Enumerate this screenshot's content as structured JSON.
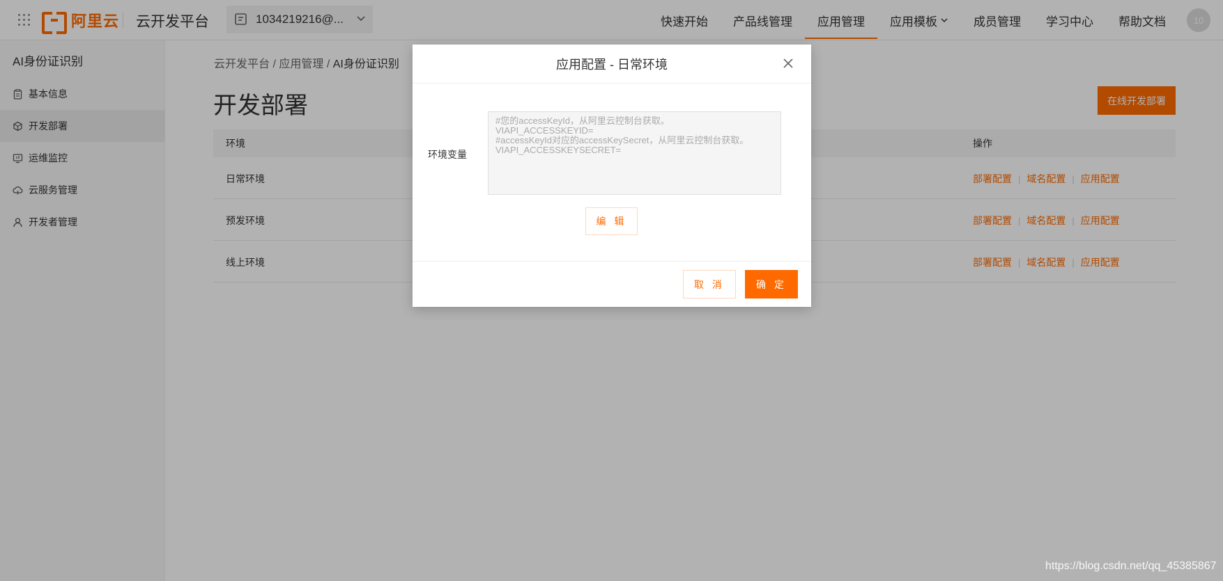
{
  "topbar": {
    "brand": "阿里云",
    "platform_title": "云开发平台",
    "account": "1034219216@...",
    "nav": [
      {
        "label": "快速开始",
        "active": false
      },
      {
        "label": "产品线管理",
        "active": false
      },
      {
        "label": "应用管理",
        "active": true
      },
      {
        "label": "应用模板",
        "active": false,
        "has_dropdown": true
      },
      {
        "label": "成员管理",
        "active": false
      },
      {
        "label": "学习中心",
        "active": false
      },
      {
        "label": "帮助文档",
        "active": false
      }
    ],
    "avatar_text": "10"
  },
  "sidebar": {
    "title": "AI身份证识别",
    "items": [
      {
        "label": "基本信息",
        "icon": "clipboard-icon",
        "active": false
      },
      {
        "label": "开发部署",
        "icon": "cube-icon",
        "active": true
      },
      {
        "label": "运维监控",
        "icon": "monitor-icon",
        "active": false
      },
      {
        "label": "云服务管理",
        "icon": "cloud-icon",
        "active": false
      },
      {
        "label": "开发者管理",
        "icon": "user-icon",
        "active": false
      }
    ]
  },
  "main": {
    "breadcrumb": [
      "云开发平台",
      "应用管理",
      "AI身份证识别"
    ],
    "breadcrumb_sep": " / ",
    "page_title": "开发部署",
    "online_deploy_label": "在线开发部署",
    "table": {
      "headers": [
        "环境",
        "操作"
      ],
      "rows": [
        {
          "env": "日常环境"
        },
        {
          "env": "预发环境"
        },
        {
          "env": "线上环境"
        }
      ],
      "ops": [
        "部署配置",
        "域名配置",
        "应用配置"
      ],
      "op_sep": "|"
    }
  },
  "modal": {
    "title": "应用配置 - 日常环境",
    "field_label": "环境变量",
    "textarea_value": "#您的accessKeyId，从阿里云控制台获取。\nVIAPI_ACCESSKEYID=\n#accessKeyId对应的accessKeySecret，从阿里云控制台获取。\nVIAPI_ACCESSKEYSECRET=",
    "edit_label": "编 辑",
    "cancel_label": "取 消",
    "ok_label": "确 定"
  },
  "watermark": "https://blog.csdn.net/qq_45385867",
  "colors": {
    "accent": "#ff6a00",
    "overlay": "rgba(0,0,0,0.3)"
  }
}
